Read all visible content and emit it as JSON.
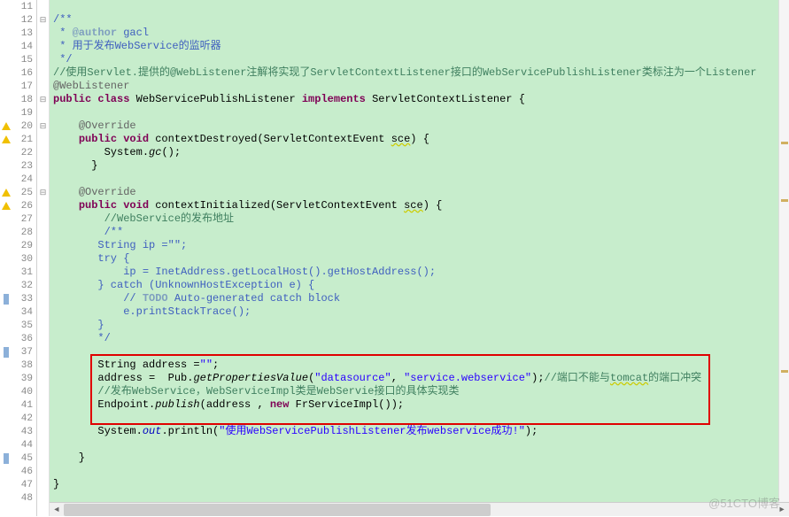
{
  "lines": [
    {
      "n": 11,
      "fold": "",
      "tokens": [
        {
          "t": "",
          "c": ""
        }
      ]
    },
    {
      "n": 12,
      "fold": "-",
      "tokens": [
        {
          "t": "/**",
          "c": "doc-comment"
        }
      ]
    },
    {
      "n": 13,
      "fold": "",
      "tokens": [
        {
          "t": " * ",
          "c": "doc-comment"
        },
        {
          "t": "@author",
          "c": "doc-tag"
        },
        {
          "t": " gacl",
          "c": "doc-comment"
        }
      ]
    },
    {
      "n": 14,
      "fold": "",
      "tokens": [
        {
          "t": " * 用于发布WebService的监听器",
          "c": "doc-comment"
        }
      ]
    },
    {
      "n": 15,
      "fold": "",
      "tokens": [
        {
          "t": " */",
          "c": "doc-comment"
        }
      ]
    },
    {
      "n": 16,
      "fold": "",
      "tokens": [
        {
          "t": "//使用Servlet.提供的@WebListener注解将实现了ServletContextListener接口的WebServicePublishListener类标注为一个Listener",
          "c": "comment"
        }
      ]
    },
    {
      "n": 17,
      "fold": "",
      "tokens": [
        {
          "t": "@WebListener",
          "c": "ann"
        }
      ]
    },
    {
      "n": 18,
      "fold": "-",
      "tokens": [
        {
          "t": "public class ",
          "c": "kw"
        },
        {
          "t": "WebServicePublishListener ",
          "c": "cls"
        },
        {
          "t": "implements ",
          "c": "kw"
        },
        {
          "t": "ServletContextListener {",
          "c": "cls"
        }
      ]
    },
    {
      "n": 19,
      "fold": "",
      "tokens": [
        {
          "t": "",
          "c": ""
        }
      ]
    },
    {
      "n": 20,
      "fold": "-",
      "mark": "warn",
      "tokens": [
        {
          "t": "    ",
          "c": ""
        },
        {
          "t": "@Override",
          "c": "ann"
        }
      ]
    },
    {
      "n": 21,
      "fold": "",
      "mark": "warn",
      "tokens": [
        {
          "t": "    ",
          "c": ""
        },
        {
          "t": "public void ",
          "c": "kw"
        },
        {
          "t": "contextDestroyed(ServletContextEvent ",
          "c": "cls"
        },
        {
          "t": "sce",
          "c": "warn"
        },
        {
          "t": ") {",
          "c": "cls"
        }
      ]
    },
    {
      "n": 22,
      "fold": "",
      "tokens": [
        {
          "t": "        System.",
          "c": "cls"
        },
        {
          "t": "gc",
          "c": "method-i"
        },
        {
          "t": "();",
          "c": "cls"
        }
      ]
    },
    {
      "n": 23,
      "fold": "",
      "tokens": [
        {
          "t": "      }",
          "c": "cls"
        }
      ]
    },
    {
      "n": 24,
      "fold": "",
      "tokens": [
        {
          "t": "",
          "c": ""
        }
      ]
    },
    {
      "n": 25,
      "fold": "-",
      "mark": "warn",
      "tokens": [
        {
          "t": "    ",
          "c": ""
        },
        {
          "t": "@Override",
          "c": "ann"
        }
      ]
    },
    {
      "n": 26,
      "fold": "",
      "mark": "warn",
      "tokens": [
        {
          "t": "    ",
          "c": ""
        },
        {
          "t": "public void ",
          "c": "kw"
        },
        {
          "t": "contextInitialized(ServletContextEvent ",
          "c": "cls"
        },
        {
          "t": "sce",
          "c": "warn"
        },
        {
          "t": ") {",
          "c": "cls"
        }
      ]
    },
    {
      "n": 27,
      "fold": "",
      "tokens": [
        {
          "t": "        ",
          "c": ""
        },
        {
          "t": "//WebService的发布地址",
          "c": "comment"
        }
      ]
    },
    {
      "n": 28,
      "fold": "",
      "tokens": [
        {
          "t": "        ",
          "c": ""
        },
        {
          "t": "/**",
          "c": "doc-comment"
        }
      ]
    },
    {
      "n": 29,
      "fold": "",
      "tokens": [
        {
          "t": "       String ip =\"\";",
          "c": "doc-comment"
        }
      ]
    },
    {
      "n": 30,
      "fold": "",
      "tokens": [
        {
          "t": "       try {",
          "c": "doc-comment"
        }
      ]
    },
    {
      "n": 31,
      "fold": "",
      "tokens": [
        {
          "t": "           ip = InetAddress.getLocalHost().getHostAddress();",
          "c": "doc-comment"
        }
      ]
    },
    {
      "n": 32,
      "fold": "",
      "tokens": [
        {
          "t": "       } catch (UnknownHostException e) {",
          "c": "doc-comment"
        }
      ]
    },
    {
      "n": 33,
      "fold": "",
      "mark": "change",
      "tokens": [
        {
          "t": "           // ",
          "c": "doc-comment"
        },
        {
          "t": "TODO",
          "c": "doc-tag"
        },
        {
          "t": " Auto-generated catch block",
          "c": "doc-comment"
        }
      ]
    },
    {
      "n": 34,
      "fold": "",
      "tokens": [
        {
          "t": "           e.printStackTrace();",
          "c": "doc-comment"
        }
      ]
    },
    {
      "n": 35,
      "fold": "",
      "tokens": [
        {
          "t": "       }",
          "c": "doc-comment"
        }
      ]
    },
    {
      "n": 36,
      "fold": "",
      "tokens": [
        {
          "t": "       */",
          "c": "doc-comment"
        }
      ]
    },
    {
      "n": 37,
      "fold": "",
      "mark": "change",
      "tokens": [
        {
          "t": "       ",
          "c": "cls"
        }
      ]
    },
    {
      "n": 38,
      "fold": "",
      "tokens": [
        {
          "t": "       String address =",
          "c": "cls"
        },
        {
          "t": "\"\"",
          "c": "str"
        },
        {
          "t": ";",
          "c": "cls"
        }
      ]
    },
    {
      "n": 39,
      "fold": "",
      "tokens": [
        {
          "t": "       address =  Pub.",
          "c": "cls"
        },
        {
          "t": "getPropertiesValue",
          "c": "method-i"
        },
        {
          "t": "(",
          "c": "cls"
        },
        {
          "t": "\"datasource\"",
          "c": "str"
        },
        {
          "t": ", ",
          "c": "cls"
        },
        {
          "t": "\"service.webservice\"",
          "c": "str"
        },
        {
          "t": ");",
          "c": "cls"
        },
        {
          "t": "//端口不能与",
          "c": "comment"
        },
        {
          "t": "tomcat",
          "c": "comment warn"
        },
        {
          "t": "的端口冲突",
          "c": "comment"
        }
      ]
    },
    {
      "n": 40,
      "fold": "",
      "tokens": [
        {
          "t": "       ",
          "c": ""
        },
        {
          "t": "//发布WebService，WebServiceImpl类是WebServie接口的具体实现类",
          "c": "comment"
        }
      ]
    },
    {
      "n": 41,
      "fold": "",
      "tokens": [
        {
          "t": "       Endpoint.",
          "c": "cls"
        },
        {
          "t": "publish",
          "c": "method-i"
        },
        {
          "t": "(address , ",
          "c": "cls"
        },
        {
          "t": "new ",
          "c": "kw"
        },
        {
          "t": "FrServiceImpl());",
          "c": "cls"
        }
      ]
    },
    {
      "n": 42,
      "fold": "",
      "tokens": [
        {
          "t": "",
          "c": ""
        }
      ]
    },
    {
      "n": 43,
      "fold": "",
      "tokens": [
        {
          "t": "       System.",
          "c": "cls"
        },
        {
          "t": "out",
          "c": "field-i"
        },
        {
          "t": ".println(",
          "c": "cls"
        },
        {
          "t": "\"使用WebServicePublishListener发布webservice成功!\"",
          "c": "str"
        },
        {
          "t": ");",
          "c": "cls"
        }
      ]
    },
    {
      "n": 44,
      "fold": "",
      "tokens": [
        {
          "t": "",
          "c": ""
        }
      ]
    },
    {
      "n": 45,
      "fold": "",
      "mark": "change",
      "tokens": [
        {
          "t": "    }",
          "c": "cls"
        }
      ]
    },
    {
      "n": 46,
      "fold": "",
      "tokens": [
        {
          "t": "",
          "c": ""
        }
      ]
    },
    {
      "n": 47,
      "fold": "",
      "tokens": [
        {
          "t": "}",
          "c": "cls"
        }
      ]
    },
    {
      "n": 48,
      "fold": "",
      "tokens": [
        {
          "t": "",
          "c": ""
        }
      ]
    }
  ],
  "watermark": "@51CTO博客",
  "scroll_arrow_left": "◄",
  "scroll_arrow_right": "►"
}
